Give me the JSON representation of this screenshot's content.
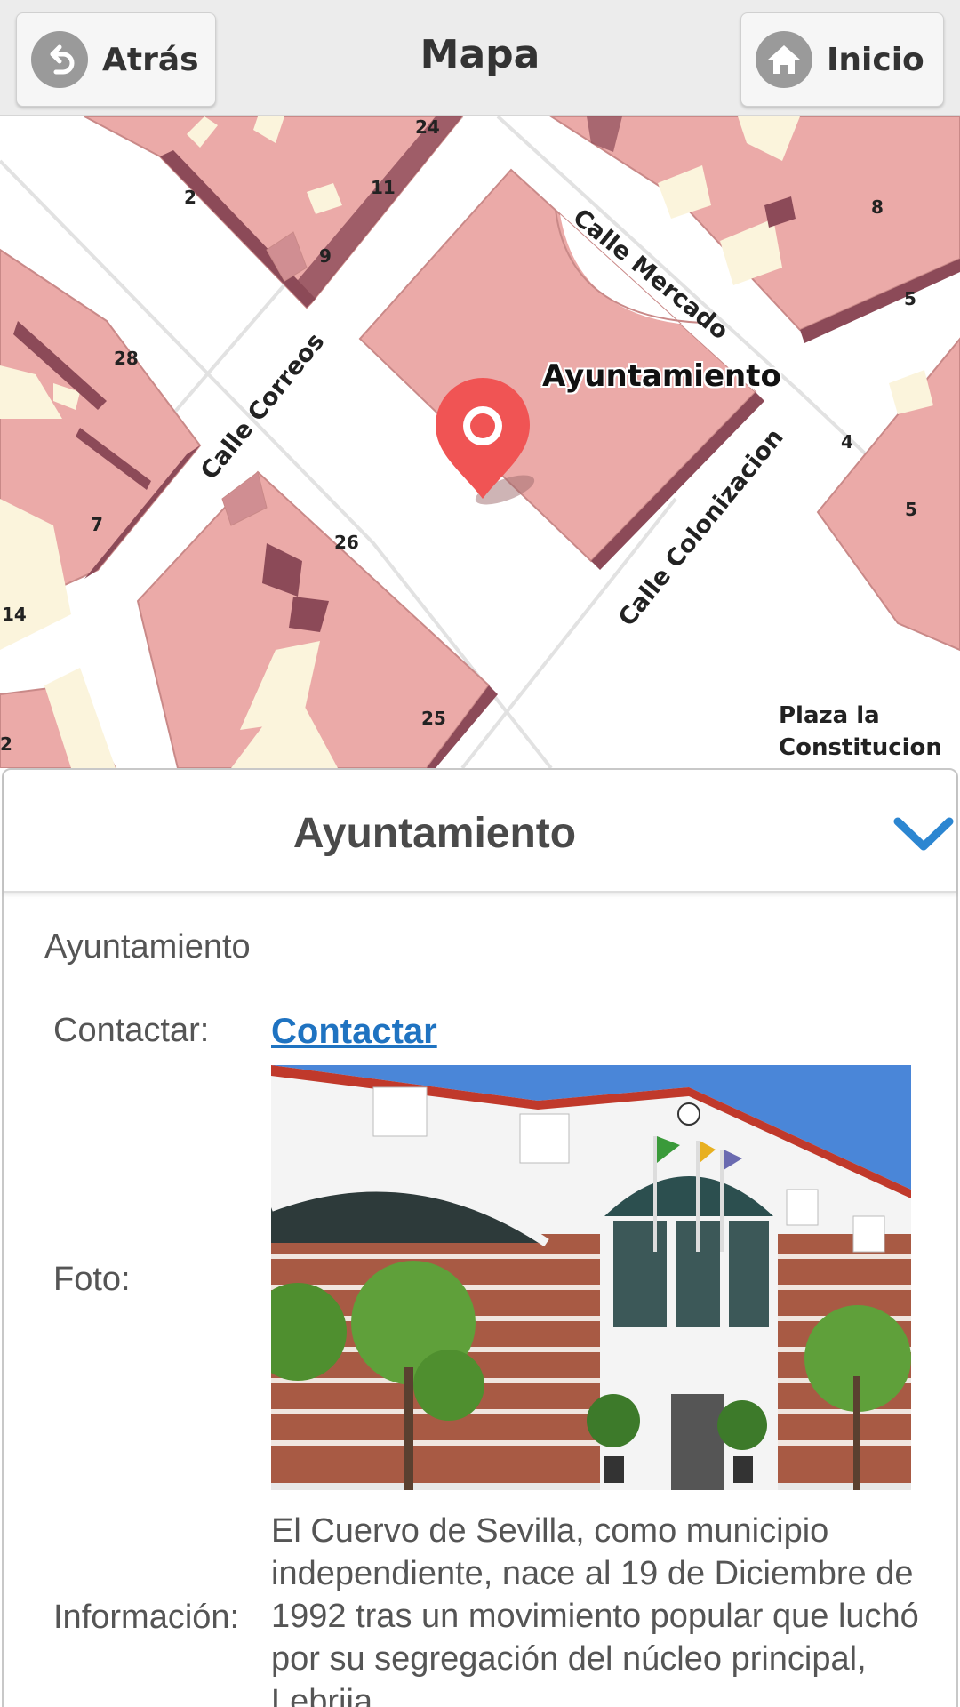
{
  "header": {
    "back_label": "Atrás",
    "title": "Mapa",
    "home_label": "Inicio"
  },
  "map": {
    "poi_label": "Ayuntamiento",
    "streets": {
      "mercado": "Calle Mercado",
      "correos": "Calle Correos",
      "colonizacion": "Calle Colonizacion"
    },
    "plaza_line1": "Plaza la",
    "plaza_line2": "Constitucion",
    "house_numbers": {
      "n24": "24",
      "n2": "2",
      "n11": "11",
      "n9": "9",
      "n8": "8",
      "n5a": "5",
      "n28": "28",
      "n4": "4",
      "n5b": "5",
      "n7": "7",
      "n26": "26",
      "n14": "14",
      "n25": "25",
      "n2b": "2"
    },
    "colors": {
      "building": "#ebaaa8",
      "building_edge": "#c98988",
      "shadow": "#8c4a58",
      "courtyard": "#fbf4dc",
      "marker": "#f05454"
    }
  },
  "panel": {
    "title": "Ayuntamiento",
    "subtitle": "Ayuntamiento",
    "contact_label": "Contactar:",
    "contact_link": "Contactar",
    "photo_label": "Foto:",
    "info_label": "Información:",
    "info_text": "El Cuervo de Sevilla, como municipio independiente, nace al 19 de Diciembre de 1992 tras un movimiento popular que luchó por su segregación del núcleo principal, Lebrija."
  }
}
